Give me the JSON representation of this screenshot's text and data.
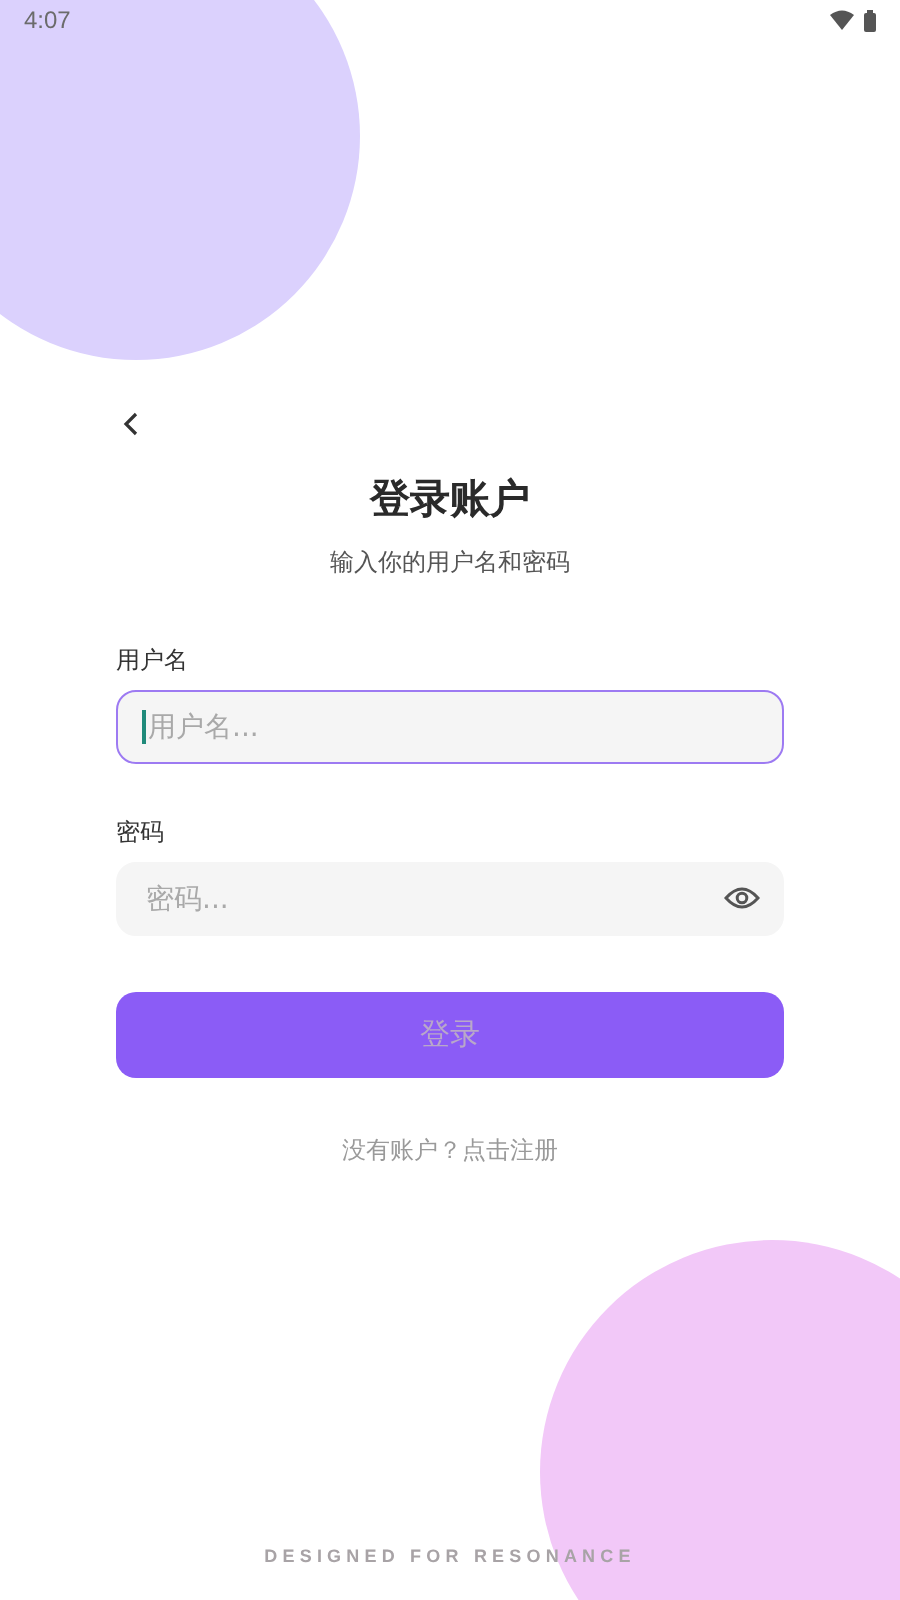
{
  "status_bar": {
    "time": "4:07"
  },
  "header": {
    "title": "登录账户",
    "subtitle": "输入你的用户名和密码"
  },
  "fields": [
    {
      "kind": "text",
      "label": "用户名",
      "placeholder": "用户名...",
      "focused": true
    },
    {
      "kind": "password",
      "label": "密码",
      "placeholder": "密码...",
      "focused": false
    }
  ],
  "login_button": {
    "label": "登录",
    "disabled": true
  },
  "register_link": "没有账户？点击注册",
  "footer": "DESIGNED FOR RESONANCE"
}
